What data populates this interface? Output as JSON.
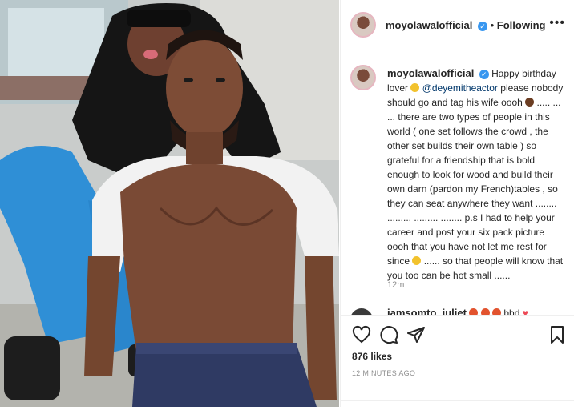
{
  "post": {
    "username": "moyolawalofficial",
    "follow_state": "Following",
    "more_icon": "more-horizontal-icon",
    "caption_parts": {
      "p1": "Happy birthday lover",
      "mention": "@deyemitheactor",
      "p2": "please nobody should go and tag his wife oooh",
      "p3": "..... ... ... there are two types of people in this world ( one set follows the crowd , the other set builds their own table ) so grateful for a friendship that is bold enough to look for wood and build their own darn (pardon my French)tables , so they can seat anywhere they want ........ ......... ......... ........ p.s I had to help your career and post your six pack picture oooh that you have not let me rest for since",
      "p4": "...... so that people will know that you too can be hot small ......"
    },
    "caption_time": "12m",
    "comment_preview": {
      "username": "iamsomto_juliet",
      "text": "bbd"
    },
    "likes": "876 likes",
    "timestamp": "12 MINUTES AGO",
    "icons": {
      "like": "heart-icon",
      "comment": "comment-icon",
      "share": "send-icon",
      "save": "bookmark-icon"
    }
  }
}
